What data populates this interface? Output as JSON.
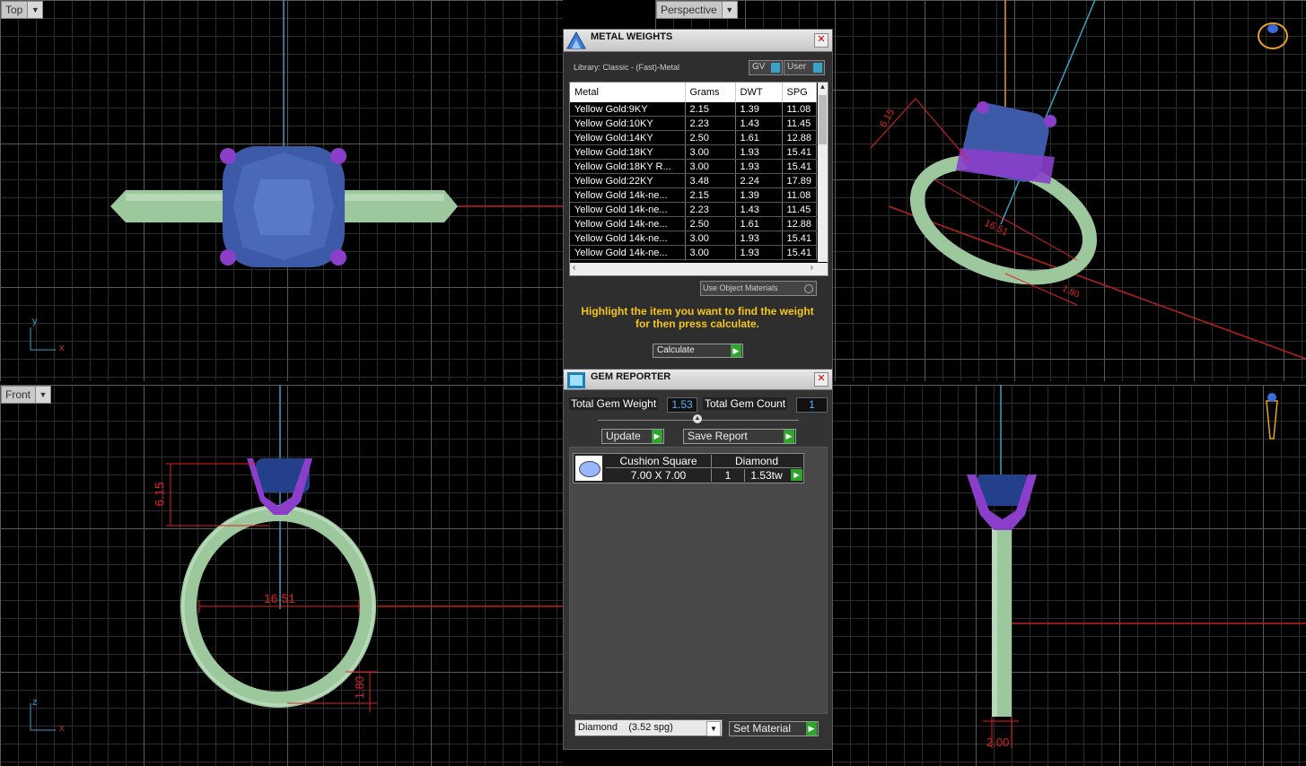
{
  "viewports": {
    "top": {
      "label": "Top",
      "axis_a": "y",
      "axis_b": "x"
    },
    "perspective": {
      "label": "Perspective",
      "dim_gem_height": "6.15",
      "dim_ring": "16.51",
      "dim_band": "1.80"
    },
    "front": {
      "label": "Front",
      "axis_a": "z",
      "axis_b": "x",
      "dim_height": "6.15",
      "dim_diameter": "16.51",
      "dim_band": "1.80"
    },
    "side": {
      "dim_width": "2.00"
    }
  },
  "metal_weights": {
    "title": "METAL WEIGHTS",
    "library": "Library: Classic - (Fast)-Metal",
    "toggle_gv": "GV",
    "toggle_user": "User",
    "columns": [
      "Metal",
      "Grams",
      "DWT",
      "SPG"
    ],
    "rows": [
      {
        "metal": "Yellow Gold:9KY",
        "grams": "2.15",
        "dwt": "1.39",
        "spg": "11.08"
      },
      {
        "metal": "Yellow Gold:10KY",
        "grams": "2.23",
        "dwt": "1.43",
        "spg": "11.45"
      },
      {
        "metal": "Yellow Gold:14KY",
        "grams": "2.50",
        "dwt": "1.61",
        "spg": "12.88"
      },
      {
        "metal": "Yellow Gold:18KY",
        "grams": "3.00",
        "dwt": "1.93",
        "spg": "15.41"
      },
      {
        "metal": "Yellow Gold:18KY R...",
        "grams": "3.00",
        "dwt": "1.93",
        "spg": "15.41"
      },
      {
        "metal": "Yellow Gold:22KY",
        "grams": "3.48",
        "dwt": "2.24",
        "spg": "17.89"
      },
      {
        "metal": "Yellow Gold 14k-ne...",
        "grams": "2.15",
        "dwt": "1.39",
        "spg": "11.08"
      },
      {
        "metal": "Yellow Gold 14k-ne...",
        "grams": "2.23",
        "dwt": "1.43",
        "spg": "11.45"
      },
      {
        "metal": "Yellow Gold 14k-ne...",
        "grams": "2.50",
        "dwt": "1.61",
        "spg": "12.88"
      },
      {
        "metal": "Yellow Gold 14k-ne...",
        "grams": "3.00",
        "dwt": "1.93",
        "spg": "15.41"
      },
      {
        "metal": "Yellow Gold 14k-ne...",
        "grams": "3.00",
        "dwt": "1.93",
        "spg": "15.41"
      }
    ],
    "use_object_materials": "Use Object Materials",
    "instruction": "Highlight the item you want to find the weight for then press calculate.",
    "calculate": "Calculate"
  },
  "gem_reporter": {
    "title": "GEM REPORTER",
    "total_weight_label": "Total Gem Weight",
    "total_weight": "1.53",
    "total_count_label": "Total Gem Count",
    "total_count": "1",
    "update": "Update",
    "save_report": "Save Report",
    "gem": {
      "shape": "Cushion Square",
      "size": "7.00 X 7.00",
      "material": "Diamond",
      "count": "1",
      "weight": "1.53tw"
    },
    "material_select": "Diamond    (3.52 spg)",
    "set_material": "Set Material"
  },
  "colors": {
    "accent_yellow": "#f5c518",
    "value_blue": "#4fb4ff",
    "green_btn": "#2fa52f",
    "metal": "#9dc79d",
    "gem": "#3d5aa8",
    "prong": "#8a3ec9",
    "dim_red": "#e02020"
  }
}
